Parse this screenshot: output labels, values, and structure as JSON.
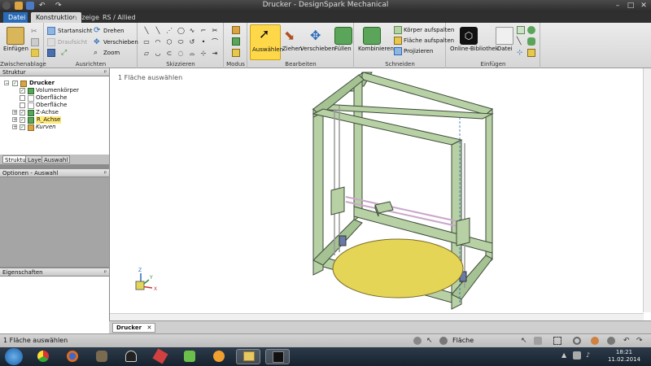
{
  "window": {
    "title": "Drucker - DesignSpark Mechanical"
  },
  "tabs": [
    "Datei",
    "Konstruktion",
    "Anzeige",
    "RS / Allied"
  ],
  "ribbon": {
    "zwischenablage": {
      "paste_label": "Einfügen",
      "group_label": "Zwischenablage"
    },
    "ausrichten": {
      "startansicht": "Startansicht",
      "draufsicht": "Draufsicht",
      "drehen": "Drehen",
      "verschieben": "Verschieben",
      "zoom": "Zoom",
      "group_label": "Ausrichten"
    },
    "skizzieren": {
      "group_label": "Skizzieren"
    },
    "modus": {
      "group_label": "Modus"
    },
    "bearbeiten": {
      "auswahlen": "Auswählen",
      "ziehen": "Ziehen",
      "verschieben": "Verschieben",
      "fullen": "Füllen",
      "group_label": "Bearbeiten"
    },
    "schneiden": {
      "kombinieren": "Kombinieren",
      "korper": "Körper aufspalten",
      "flache": "Fläche aufspalten",
      "projizieren": "Projizieren",
      "group_label": "Schneiden"
    },
    "einfugen": {
      "online": "Online-Bibliothek",
      "datei": "Datei",
      "group_label": "Einfügen"
    }
  },
  "panels": {
    "struktur": "Struktur",
    "optionen": "Optionen - Auswahl",
    "eigenschaften": "Eigenschaften",
    "tabs": [
      "Struktur",
      "Layer",
      "Auswahl"
    ]
  },
  "tree": [
    {
      "label": "Drucker",
      "bold": true,
      "checked": true,
      "icon_color": "#d9a441"
    },
    {
      "label": "Volumenkörper",
      "checked": true,
      "icon_color": "#5aa55a"
    },
    {
      "label": "Oberfläche",
      "checked": false,
      "icon_color": "#ffffff"
    },
    {
      "label": "Oberfläche",
      "checked": false,
      "icon_color": "#ffffff"
    },
    {
      "label": "Z-Achse",
      "checked": true,
      "icon_color": "#5aa55a"
    },
    {
      "label": "R_Achse",
      "checked": true,
      "icon_color": "#5aa55a",
      "highlight": "#ffe97a"
    },
    {
      "label": "Kurven",
      "checked": true,
      "icon_color": "#d9a441",
      "italic": true
    }
  ],
  "viewport": {
    "hint": "1 Fläche auswählen",
    "axis_labels": {
      "x": "X",
      "y": "Y",
      "z": "Z"
    }
  },
  "document_tab": "Drucker",
  "status": {
    "message": "1 Fläche auswählen",
    "filter": "Fläche"
  },
  "clock": {
    "time": "18:21",
    "date": "11.02.2014"
  },
  "colors": {
    "frame": "#b7d1a5",
    "frame_stroke": "#3d4a3a",
    "plate": "#e5d556",
    "accent_blue": "#2a6bb8"
  },
  "icons": [
    "app-menu-icon",
    "save-icon",
    "undo-icon",
    "redo-icon",
    "paste-icon",
    "rotate-icon",
    "zoom-icon",
    "select-arrow-icon",
    "pull-icon",
    "move-icon",
    "fill-icon",
    "combine-icon",
    "online-library-icon",
    "file-icon"
  ]
}
